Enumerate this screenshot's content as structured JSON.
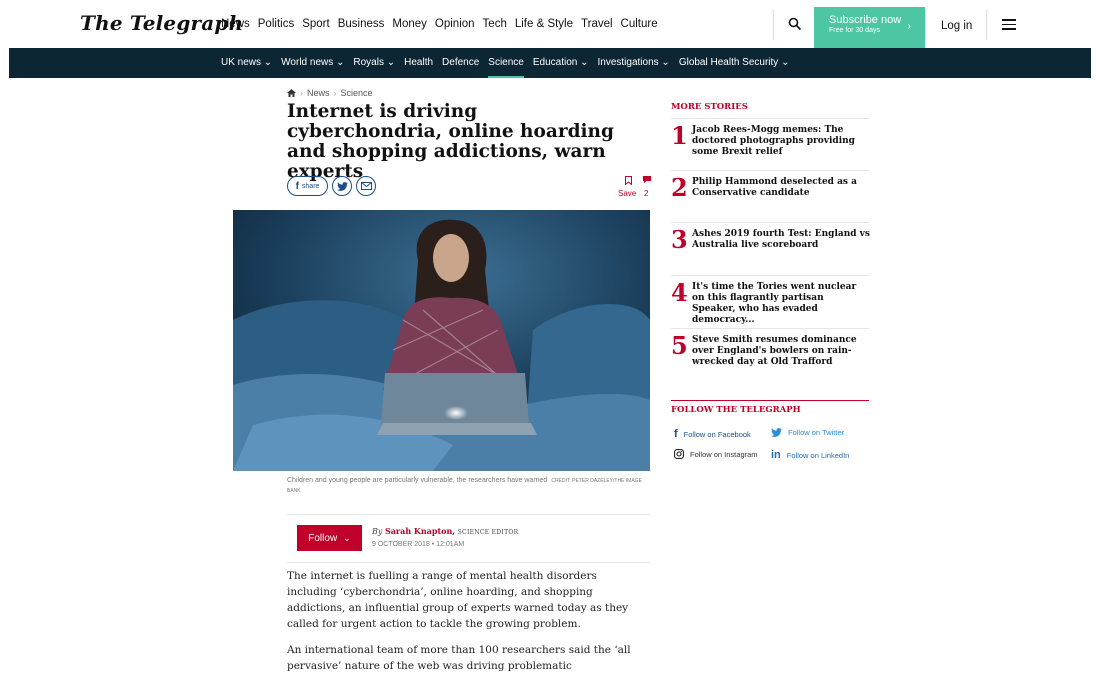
{
  "header": {
    "logo": "The Telegraph",
    "nav": [
      "News",
      "Politics",
      "Sport",
      "Business",
      "Money",
      "Opinion",
      "Tech",
      "Life & Style",
      "Travel",
      "Culture"
    ],
    "subscribe_label": "Subscribe now",
    "subscribe_sub": "Free for 30 days",
    "login_label": "Log in"
  },
  "subnav": {
    "items": [
      "UK news ⌄",
      "World news ⌄",
      "Royals ⌄",
      "Health",
      "Defence",
      "Science",
      "Education ⌄",
      "Investigations ⌄",
      "Global Health Security ⌄"
    ],
    "active": "Science"
  },
  "breadcrumb": {
    "items": [
      "News",
      "Science"
    ]
  },
  "article": {
    "headline": "Internet is driving cyberchondria, online hoarding and shopping addictions, warn experts",
    "share_label": "share",
    "save_label": "Save",
    "comment_count": "2",
    "caption": "Children and young people are particularly vulnerable, the researchers have warned",
    "credit": "CREDIT: PETER DAZELEY/THE IMAGE BANK",
    "follow_label": "Follow",
    "by": "By",
    "author": "Sarah Knapton,",
    "author_role": "SCIENCE EDITOR",
    "date": "9 OCTOBER 2018 • 12:01AM",
    "paragraphs": [
      "The internet is fuelling a range of mental health disorders including ‘cyberchondria’, online hoarding, and shopping addictions, an influential group of experts warned today as they called for urgent action to tackle the growing problem.",
      "An international team of more than 100 researchers said the ‘all pervasive’ nature of the web was driving problematic pornography use,"
    ]
  },
  "sidebar": {
    "more_title": "MORE STORIES",
    "stories": [
      {
        "num": "1",
        "title": "Jacob Rees-Mogg memes: The doctored photographs providing some Brexit relief"
      },
      {
        "num": "2",
        "title": "Philip Hammond deselected as a Conservative candidate"
      },
      {
        "num": "3",
        "title": "Ashes 2019 fourth Test: England vs Australia live scoreboard"
      },
      {
        "num": "4",
        "title": "It's time the Tories went nuclear on this flagrantly partisan Speaker, who has evaded democracy..."
      },
      {
        "num": "5",
        "title": "Steve Smith resumes dominance over England's bowlers on rain-wrecked day at Old Trafford"
      }
    ],
    "follow_title": "FOLLOW THE TELEGRAPH",
    "social": {
      "facebook": "Follow on Facebook",
      "twitter": "Follow on Twitter",
      "instagram": "Follow on Instagram",
      "linkedin": "Follow on LinkedIn"
    }
  },
  "colors": {
    "accent": "#c0002a",
    "subscribe": "#4dc7a3",
    "subnav_bg": "#0d2633",
    "share_blue": "#1d4e89"
  }
}
